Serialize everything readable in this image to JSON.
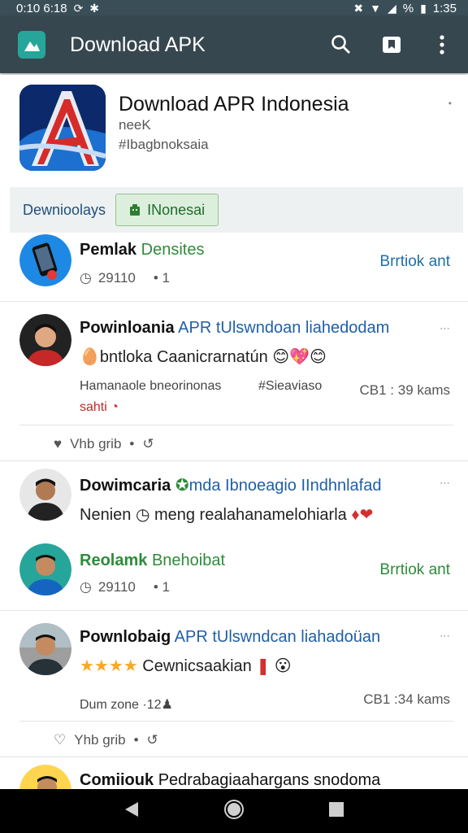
{
  "status": {
    "time_left": "0:10 6:18",
    "time_right": "1:35",
    "pct": "%"
  },
  "appbar": {
    "title": "Download APK",
    "search_icon": "search-icon",
    "bookmark_icon": "bookmark-icon",
    "more_icon": "more-vert-icon"
  },
  "header": {
    "title": "Download APR Indonesia",
    "sub1": "neeK",
    "sub2": "#Ibagbnoksaia",
    "more": "•"
  },
  "tabs": {
    "tab1": "Dewnioolays",
    "chip": "INonesai"
  },
  "feed": {
    "item1": {
      "name_a": "Pemlak",
      "name_b": "Densites",
      "meta_a": "29110",
      "meta_b": "•  1",
      "right": "Brrtiok ant"
    },
    "item2": {
      "name_a": "Powinloania",
      "name_b": "APR tUlswndoan liahedodam",
      "line2": "bntloka Caanicrarnatún",
      "meta_left": "Hamanaole bneorinonas",
      "meta_mid": "#Sieaviaso",
      "meta_right": "CB1 : 39 kams",
      "tag": "sahti",
      "like": "Vhb grib",
      "dot": "•"
    },
    "item3": {
      "name_a": "Dowimcaria",
      "name_b": "mda Ibnoeagio IIndhnlafad",
      "line2_a": "Nenien",
      "line2_b": "meng realahanamelohiarla"
    },
    "item4": {
      "name_a": "Reolamk",
      "name_b": "Bnehoibat",
      "meta_a": "29110",
      "meta_b": "•  1",
      "right": "Brrtiok ant"
    },
    "item5": {
      "name_a": "Pownlobaig",
      "name_b": "APR tUlswndcan liahadoüan",
      "line2": "Cewnicsaakian",
      "meta_left": "Dum zone",
      "meta_num": "·12",
      "meta_right": "CB1 :34 kams",
      "like": "Yhb grib",
      "dot": "•"
    },
    "item6": {
      "name_a": "Comiiouk",
      "name_b": "Pedrabagiaahargans snodoma"
    }
  },
  "colors": {
    "appbar": "#37474f",
    "accent": "#26a69a",
    "link_blue": "#1f5fa8",
    "link_green": "#2e8b3a"
  }
}
